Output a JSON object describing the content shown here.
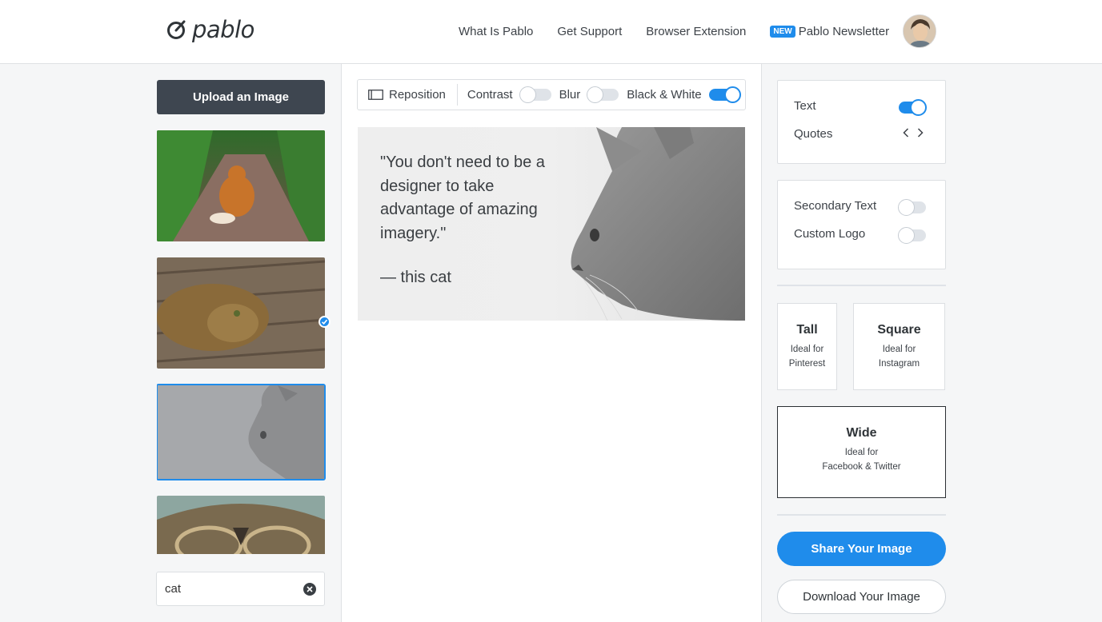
{
  "header": {
    "logo_text": "pablo",
    "logo_icon": "pablo-logo-icon",
    "nav": {
      "what_is": "What Is Pablo",
      "support": "Get Support",
      "extension": "Browser Extension",
      "badge": "NEW",
      "newsletter": "Pablo Newsletter"
    },
    "avatar_icon": "user-avatar"
  },
  "left": {
    "upload_label": "Upload an Image",
    "thumbnails": [
      {
        "name": "orange-cat-on-path",
        "selected": false
      },
      {
        "name": "tabby-cat-on-deck",
        "selected": false
      },
      {
        "name": "gray-cat-profile",
        "selected": true
      },
      {
        "name": "cat-with-glasses",
        "selected": false
      }
    ],
    "search": {
      "value": "cat",
      "clear_icon": "clear-icon"
    }
  },
  "toolbar": {
    "reposition": "Reposition",
    "contrast": "Contrast",
    "contrast_on": false,
    "blur": "Blur",
    "blur_on": false,
    "bw": "Black & White",
    "bw_on": true
  },
  "canvas": {
    "quote": "\"You don't need to be a designer to take advantage of amazing imagery.\"",
    "author": "— this cat"
  },
  "right": {
    "text_label": "Text",
    "text_on": true,
    "quotes_label": "Quotes",
    "secondary_label": "Secondary Text",
    "secondary_on": false,
    "logo_label": "Custom Logo",
    "logo_on": false,
    "sizes": {
      "tall": {
        "title": "Tall",
        "desc1": "Ideal for",
        "desc2": "Pinterest"
      },
      "square": {
        "title": "Square",
        "desc1": "Ideal for",
        "desc2": "Instagram"
      },
      "wide": {
        "title": "Wide",
        "desc1": "Ideal for",
        "desc2": "Facebook & Twitter",
        "selected": true
      }
    },
    "share_label": "Share Your Image",
    "download_label": "Download Your Image"
  },
  "colors": {
    "accent": "#1f8ceb",
    "upload_button": "#3e4650",
    "panel_bg": "#f5f6f7"
  }
}
